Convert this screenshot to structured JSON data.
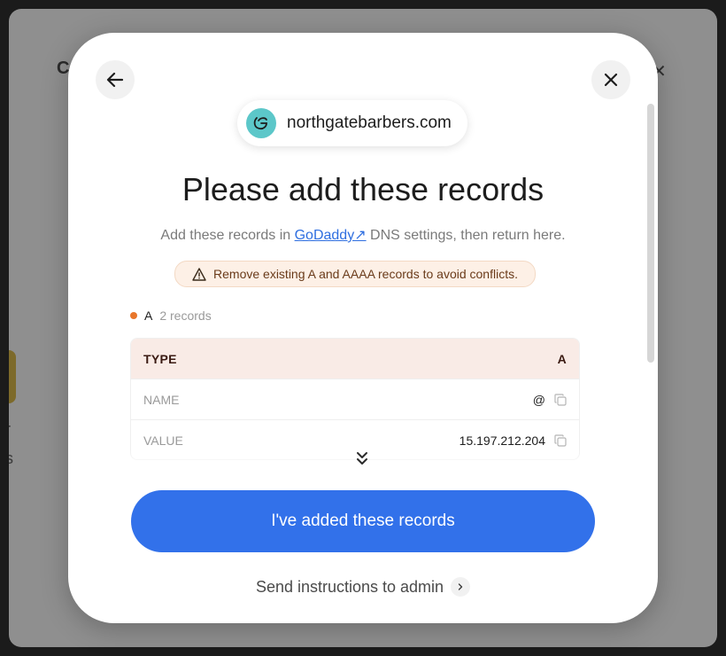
{
  "background": {
    "letter": "C",
    "close_glyph": "✕",
    "partial_text_1": "r",
    "partial_text_2": "s"
  },
  "modal": {
    "back_icon": "arrow-left-icon",
    "close_icon": "close-icon",
    "domain": "northgatebarbers.com",
    "title": "Please add these records",
    "subtitle_before": "Add these records in ",
    "provider_link": "GoDaddy↗",
    "subtitle_after": " DNS settings, then return here.",
    "warning": "Remove existing A and AAAA records to avoid conflicts.",
    "record_group": {
      "type": "A",
      "count": "2 records",
      "dot_color": "#e8762b"
    },
    "table": {
      "type_label": "TYPE",
      "type_value": "A",
      "rows": [
        {
          "label": "NAME",
          "value": "@"
        },
        {
          "label": "VALUE",
          "value": "15.197.212.204"
        }
      ]
    },
    "primary_button": "I've added these records",
    "secondary_link": "Send instructions to admin"
  },
  "colors": {
    "accent": "#3271ea",
    "warning_bg": "#fdf0e6",
    "table_header_bg": "#f9ebe6",
    "logo_bg": "#5cc7c9"
  }
}
